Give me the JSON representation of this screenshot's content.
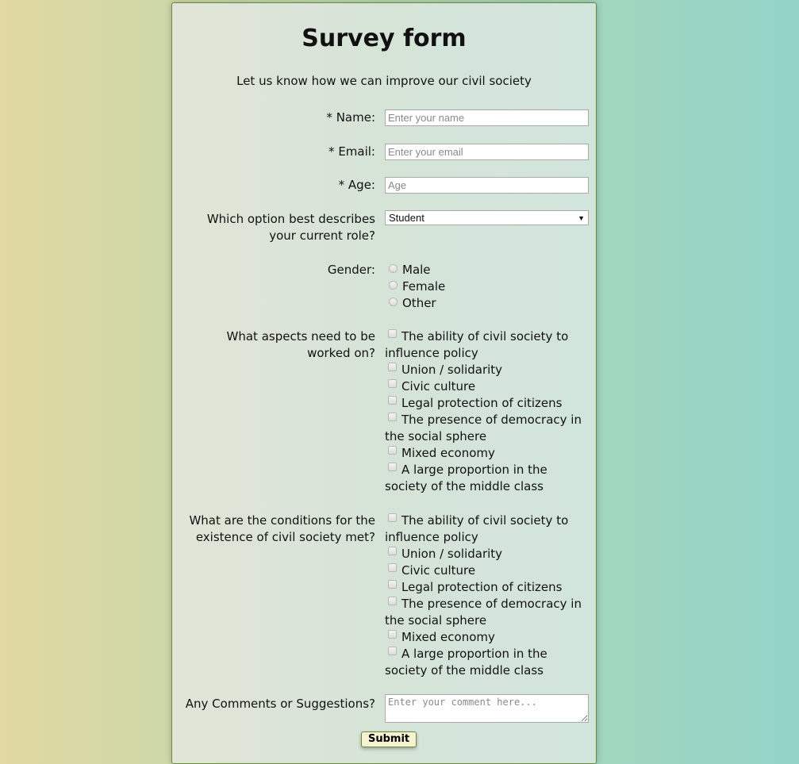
{
  "form": {
    "title": "Survey form",
    "description": "Let us know how we can improve our civil society",
    "name": {
      "label": "* Name:",
      "placeholder": "Enter your name",
      "value": ""
    },
    "email": {
      "label": "* Email:",
      "placeholder": "Enter your email",
      "value": ""
    },
    "age": {
      "label": "* Age:",
      "placeholder": "Age",
      "value": ""
    },
    "role": {
      "label": "Which option best describes your current role?",
      "selected": "Student"
    },
    "gender": {
      "label": "Gender:",
      "options": [
        "Male",
        "Female",
        "Other"
      ]
    },
    "aspects": {
      "label": "What aspects need to be worked on?",
      "options": [
        "The ability of civil society to influence policy",
        "Union / solidarity",
        "Civic culture",
        "Legal protection of citizens",
        "The presence of democracy in the social sphere",
        "Mixed economy",
        "A large proportion in the society of the middle class"
      ]
    },
    "conditions": {
      "label": "What are the conditions for the existence of civil society met?",
      "options": [
        "The ability of civil society to influence policy",
        "Union / solidarity",
        "Civic culture",
        "Legal protection of citizens",
        "The presence of democracy in the social sphere",
        "Mixed economy",
        "A large proportion in the society of the middle class"
      ]
    },
    "comments": {
      "label": "Any Comments or Suggestions?",
      "placeholder": "Enter your comment here..."
    },
    "submit_label": "Submit"
  },
  "colors": {
    "card_border": "#6b8a3a",
    "submit_bg": "#f6f3d2"
  }
}
